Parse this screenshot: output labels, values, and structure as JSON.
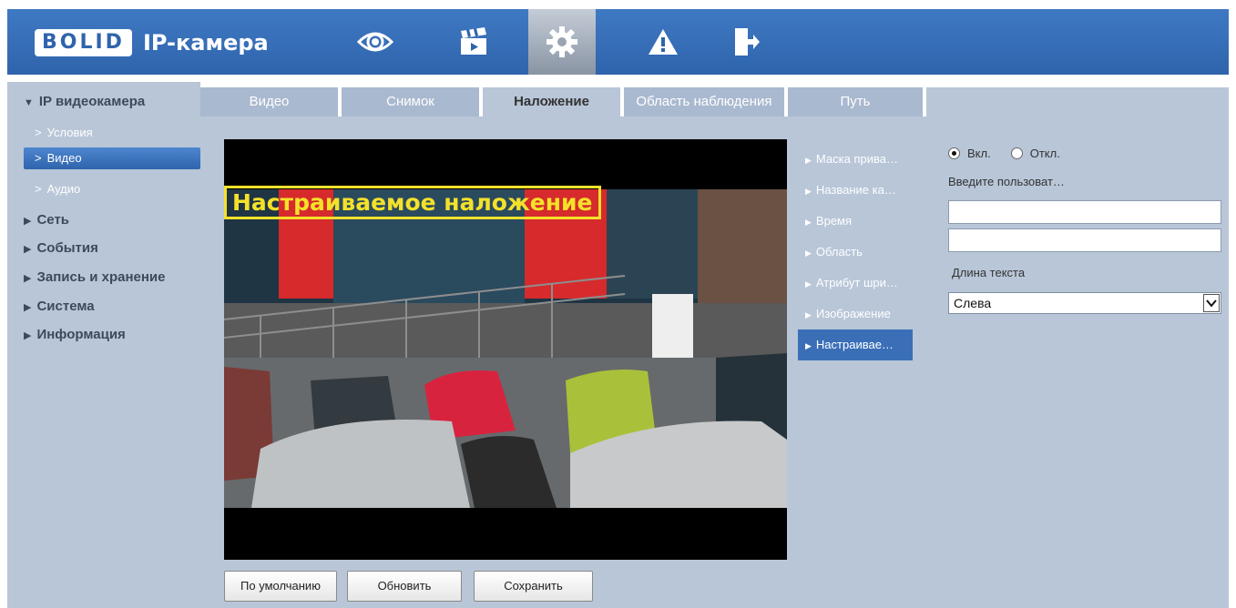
{
  "header": {
    "logo_brand": "BOLID",
    "logo_product": "IP-камера",
    "nav": [
      {
        "icon": "eye-icon",
        "label": "Просмотр"
      },
      {
        "icon": "clapperboard-icon",
        "label": "Воспроизведение"
      },
      {
        "icon": "gear-icon",
        "label": "Настройка",
        "active": true
      },
      {
        "icon": "warning-icon",
        "label": "Тревога"
      },
      {
        "icon": "logout-icon",
        "label": "Выход"
      }
    ]
  },
  "sidebar": {
    "groups": [
      {
        "label": "IP видеокамера",
        "expanded": true
      },
      {
        "label": "Сеть"
      },
      {
        "label": "События"
      },
      {
        "label": "Запись и хранение"
      },
      {
        "label": "Система"
      },
      {
        "label": "Информация"
      }
    ],
    "subitems": [
      "Условия",
      "Видео",
      "Аудио"
    ],
    "active_subitem": "Видео"
  },
  "tabs": [
    "Видео",
    "Снимок",
    "Наложение",
    "Область наблюдения",
    "Путь"
  ],
  "active_tab": "Наложение",
  "video": {
    "overlay_text": "Настраиваемое наложение",
    "overlay_color": "#f4e12a"
  },
  "overlay_menu": {
    "items": [
      "Маска прива…",
      "Название ка…",
      "Время",
      "Область",
      "Атрибут шри…",
      "Изображение",
      "Настраивае…"
    ],
    "active_index": 6
  },
  "settings": {
    "enable_label": "Вкл.",
    "disable_label": "Откл.",
    "enabled": true,
    "input_prompt": "Введите пользоват…",
    "text_line1": "",
    "text_line2": "",
    "length_label": "Длина текста",
    "alignment_value": "Слева"
  },
  "buttons": {
    "default": "По умолчанию",
    "refresh": "Обновить",
    "save": "Сохранить"
  },
  "colors": {
    "header_blue": "#2f64ac",
    "panel_bg": "#b8c6d8",
    "active_blue": "#3a6fb8"
  }
}
